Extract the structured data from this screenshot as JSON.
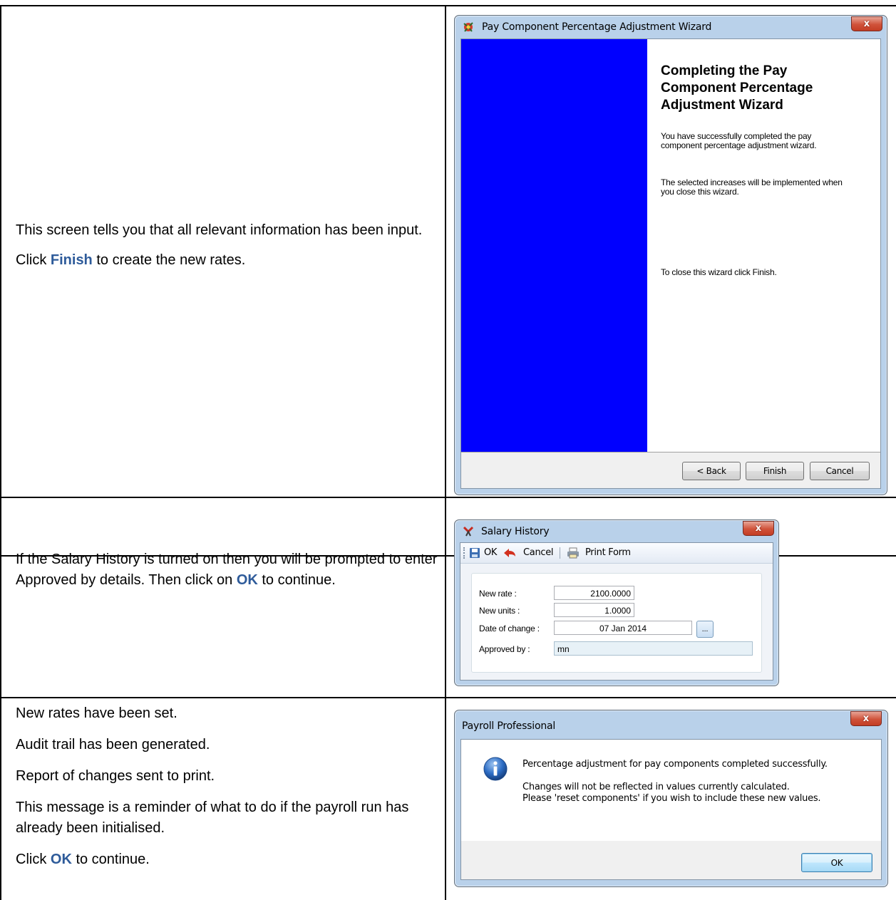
{
  "section1": {
    "desc_line1": "This screen tells you that all relevant information has been input.",
    "desc_click_prefix": "Click ",
    "desc_click_keyword": "Finish",
    "desc_click_suffix": " to create the new rates.",
    "wizard": {
      "title": "Pay Component Percentage Adjustment Wizard",
      "heading": "Completing the Pay Component Percentage Adjustment Wizard",
      "para1": "You have successfully completed the pay component percentage adjustment wizard.",
      "para2": "The selected increases will be implemented when you close this wizard.",
      "para3": "To close this wizard click Finish.",
      "back_label": "< Back",
      "finish_label": "Finish",
      "cancel_label": "Cancel",
      "side_color": "#0000ff"
    }
  },
  "section2": {
    "desc_text": "If the Salary History is turned on then you will be prompted to enter Approved by details. Then click on ",
    "desc_keyword": "OK",
    "desc_suffix": " to continue.",
    "salary_history": {
      "title": "Salary History",
      "toolbar": {
        "ok": "OK",
        "cancel": "Cancel",
        "print_form": "Print Form"
      },
      "new_rate_label": "New rate :",
      "new_rate_value": "2100.0000",
      "new_units_label": "New units :",
      "new_units_value": "1.0000",
      "date_label": "Date of change :",
      "date_value": "07 Jan 2014",
      "browse_label": "...",
      "approved_label": "Approved by :",
      "approved_value": "mn"
    }
  },
  "section3": {
    "lines": [
      "New rates have been set.",
      "Audit trail has been generated.",
      "Report of changes sent to print.",
      "This message is a reminder of what to do if the payroll run has already been initialised."
    ],
    "click_prefix": "Click ",
    "click_keyword": "OK",
    "click_suffix": " to continue.",
    "message_box": {
      "title": "Payroll Professional",
      "line1": "Percentage adjustment for pay components completed successfully.",
      "line2": "Changes will not be reflected in values currently calculated.",
      "line3": "Please 'reset components' if you wish to include these new values.",
      "ok_label": "OK"
    }
  },
  "colors": {
    "keyword": "#2e5b9a",
    "close_button": "#c33d24"
  }
}
